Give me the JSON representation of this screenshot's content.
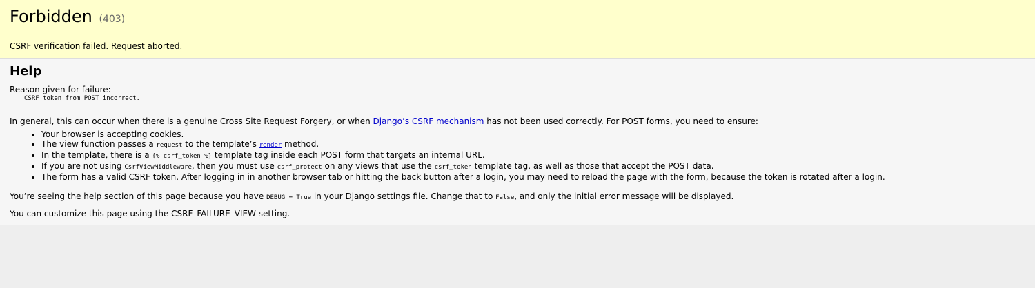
{
  "summary": {
    "title": "Forbidden",
    "code": "(403)",
    "message": "CSRF verification failed. Request aborted."
  },
  "help": {
    "heading": "Help",
    "reason_label": "Reason given for failure:",
    "reason": "CSRF token from POST incorrect.",
    "general_before": "In general, this can occur when there is a genuine Cross Site Request Forgery, or when ",
    "general_link": "Django’s CSRF mechanism",
    "general_after": " has not been used correctly. For POST forms, you need to ensure:",
    "items": {
      "item1": "Your browser is accepting cookies.",
      "item2_a": "The view function passes a ",
      "item2_code": "request",
      "item2_b": " to the template’s ",
      "item2_link": "render",
      "item2_c": " method.",
      "item3_a": "In the template, there is a ",
      "item3_code": "{% csrf_token %}",
      "item3_b": " template tag inside each POST form that targets an internal URL.",
      "item4_a": "If you are not using ",
      "item4_code1": "CsrfViewMiddleware",
      "item4_b": ", then you must use ",
      "item4_code2": "csrf_protect",
      "item4_c": " on any views that use the ",
      "item4_code3": "csrf_token",
      "item4_d": " template tag, as well as those that accept the POST data.",
      "item5": "The form has a valid CSRF token. After logging in in another browser tab or hitting the back button after a login, you may need to reload the page with the form, because the token is rotated after a login."
    },
    "debug_a": "You’re seeing the help section of this page because you have ",
    "debug_code1": "DEBUG = True",
    "debug_b": " in your Django settings file. Change that to ",
    "debug_code2": "False",
    "debug_c": ", and only the initial error message will be displayed.",
    "customize": "You can customize this page using the CSRF_FAILURE_VIEW setting."
  }
}
